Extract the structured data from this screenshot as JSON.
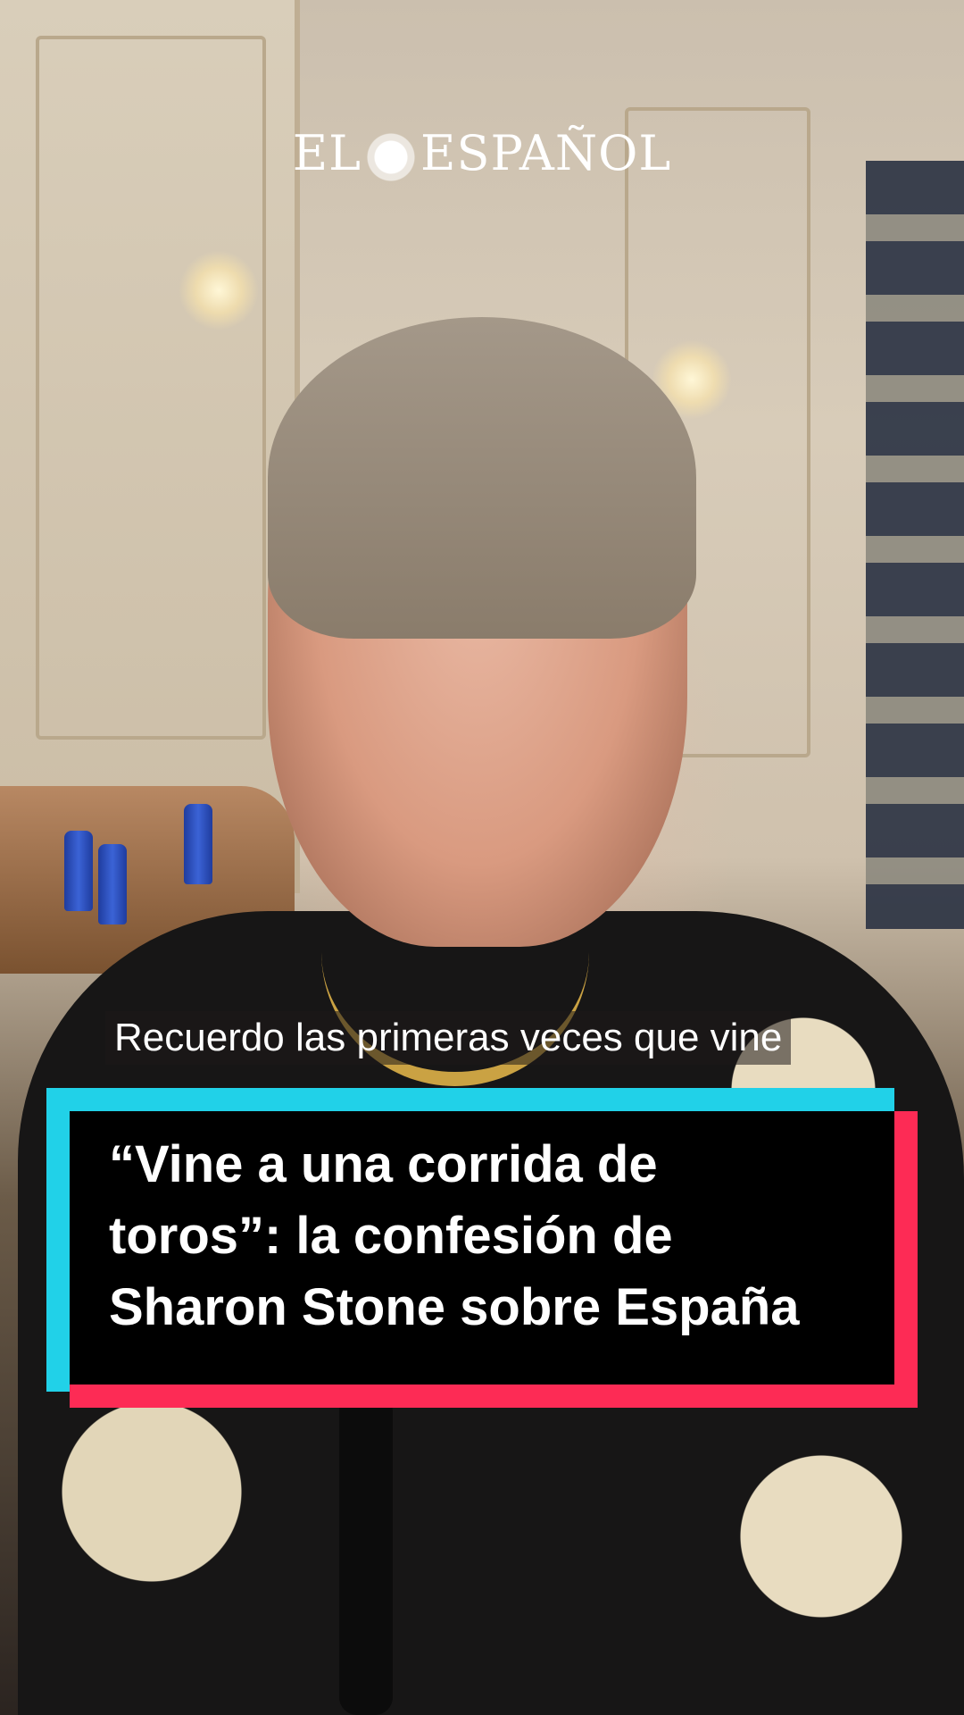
{
  "brand": {
    "logo_left": "EL",
    "logo_right": "ESPAÑOL"
  },
  "caption": {
    "subtitle": "Recuerdo las primeras veces que vine"
  },
  "headline": {
    "lines": [
      "“Vine a una corrida de",
      "toros”: la confesión de",
      "Sharon Stone sobre España"
    ]
  },
  "colors": {
    "card_bg": "#000000",
    "accent_cyan": "#21d1e8",
    "accent_pink": "#fd2b55",
    "text": "#ffffff"
  }
}
